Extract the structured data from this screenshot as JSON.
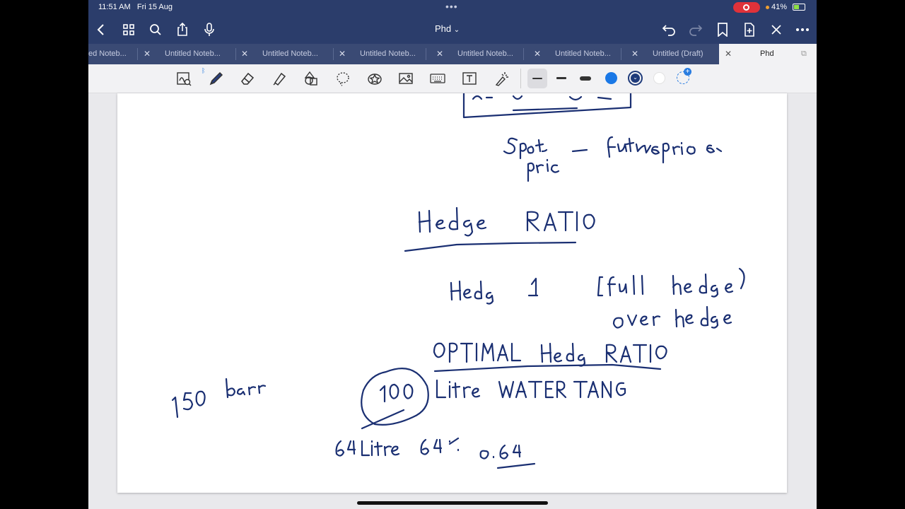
{
  "status": {
    "time": "11:51 AM",
    "date": "Fri 15 Aug",
    "battery": "41%"
  },
  "nav": {
    "title": "Phd",
    "title_chevron": "⌄"
  },
  "tabs": [
    {
      "label": "ed Noteb..."
    },
    {
      "label": "Untitled Noteb..."
    },
    {
      "label": "Untitled Noteb..."
    },
    {
      "label": "Untitled Noteb..."
    },
    {
      "label": "Untitled Noteb..."
    },
    {
      "label": "Untitled Noteb..."
    },
    {
      "label": "Untitled (Draft)"
    },
    {
      "label": "Phd"
    }
  ],
  "toolbar": {
    "tools": [
      "zoom-window",
      "pen",
      "eraser",
      "highlighter",
      "shapes",
      "lasso",
      "sticker",
      "image",
      "keyboard",
      "text-box",
      "laser-pointer"
    ],
    "pen_colors": [
      "#1a78e6",
      "#1e3a7a",
      "#ffffff"
    ],
    "stroke_widths": [
      "thin",
      "medium",
      "thick"
    ]
  },
  "colors": {
    "ink": "#1a2f72",
    "chrome": "#2b3d6b"
  }
}
